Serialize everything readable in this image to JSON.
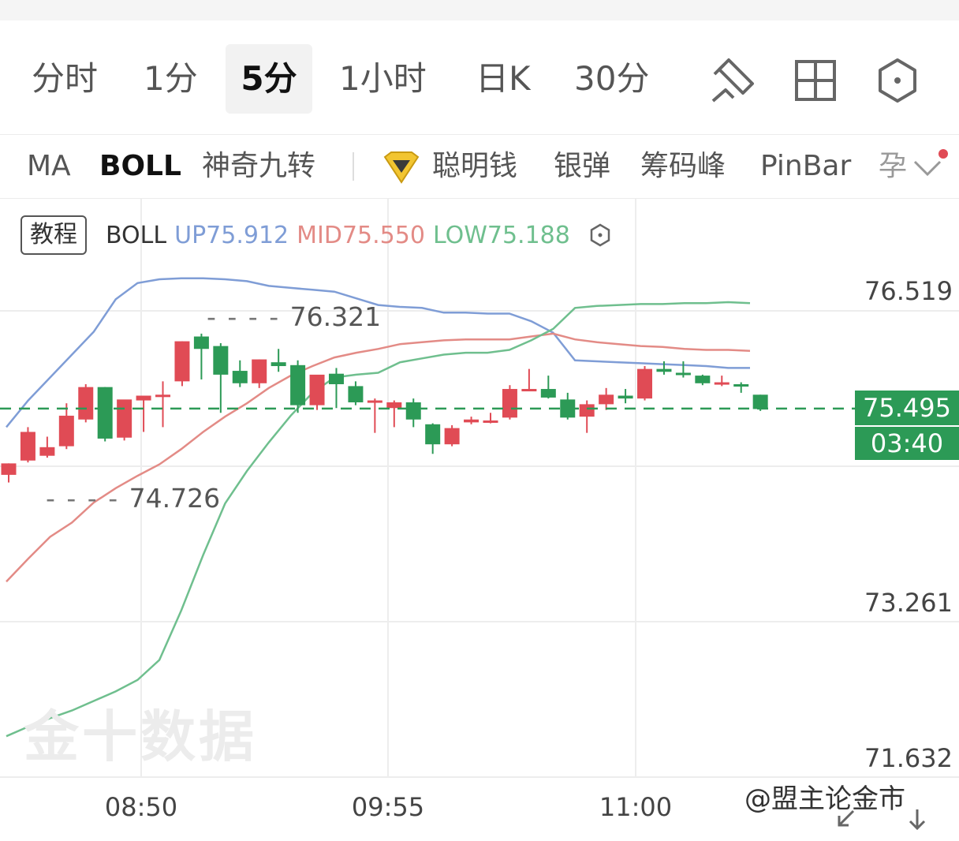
{
  "toolbar": {
    "tabs": [
      "分时",
      "1分",
      "5分",
      "1小时",
      "日K",
      "30分"
    ],
    "active_tab": "5分",
    "icons": [
      "draw-pencil-icon",
      "layout-grid-icon",
      "settings-hexagon-icon"
    ]
  },
  "indicators": {
    "items": [
      "MA",
      "BOLL",
      "神奇九转",
      "聪明钱",
      "银弹",
      "筹码峰",
      "PinBar",
      "孕"
    ],
    "active": "BOLL",
    "more_icon": "chevron-down-icon"
  },
  "legend": {
    "tutorial": "教程",
    "name": "BOLL",
    "up": "UP75.912",
    "mid": "MID75.550",
    "low": "LOW75.188"
  },
  "price": {
    "current": "75.495",
    "countdown": "03:40"
  },
  "watermark": "金十数据",
  "credit": "@盟主论金市",
  "colors": {
    "up": "#e04b55",
    "down": "#2c9a56",
    "upper_band": "#7f9dd6",
    "mid_band": "#e38b86",
    "lower_band": "#6fbf8e",
    "dashed": "#2c9a56"
  },
  "chart_data": {
    "type": "candlestick",
    "y_ticks": [
      "76.519",
      "73.261",
      "71.632"
    ],
    "x_ticks": [
      "08:50",
      "09:55",
      "11:00"
    ],
    "high_label": "76.321",
    "low_label": "74.726",
    "ylim": [
      71.632,
      76.519
    ],
    "current_price": 75.495,
    "candles": [
      {
        "o": 74.8,
        "h": 74.92,
        "c": 74.92,
        "l": 74.72
      },
      {
        "o": 74.95,
        "h": 75.3,
        "c": 75.25,
        "l": 74.93
      },
      {
        "o": 75.0,
        "h": 75.2,
        "c": 75.09,
        "l": 74.98
      },
      {
        "o": 75.1,
        "h": 75.55,
        "c": 75.42,
        "l": 75.07
      },
      {
        "o": 75.38,
        "h": 75.75,
        "c": 75.72,
        "l": 75.35
      },
      {
        "o": 75.72,
        "h": 75.72,
        "c": 75.18,
        "l": 75.15
      },
      {
        "o": 75.19,
        "h": 75.58,
        "c": 75.59,
        "l": 75.16
      },
      {
        "o": 75.58,
        "h": 75.6,
        "c": 75.63,
        "l": 75.25
      },
      {
        "o": 75.63,
        "h": 75.78,
        "c": 75.64,
        "l": 75.3
      },
      {
        "o": 75.78,
        "h": 76.2,
        "c": 76.2,
        "l": 75.73
      },
      {
        "o": 76.25,
        "h": 76.28,
        "c": 76.12,
        "l": 75.8
      },
      {
        "o": 76.15,
        "h": 76.18,
        "c": 75.85,
        "l": 75.45
      },
      {
        "o": 75.89,
        "h": 76.0,
        "c": 75.76,
        "l": 75.72
      },
      {
        "o": 75.76,
        "h": 76.01,
        "c": 76.01,
        "l": 75.71
      },
      {
        "o": 75.98,
        "h": 76.12,
        "c": 75.94,
        "l": 75.88
      },
      {
        "o": 75.95,
        "h": 76.0,
        "c": 75.53,
        "l": 75.45
      },
      {
        "o": 75.53,
        "h": 75.84,
        "c": 75.85,
        "l": 75.48
      },
      {
        "o": 75.86,
        "h": 75.92,
        "c": 75.75,
        "l": 75.5
      },
      {
        "o": 75.73,
        "h": 75.78,
        "c": 75.56,
        "l": 75.53
      },
      {
        "o": 75.56,
        "h": 75.6,
        "c": 75.58,
        "l": 75.24
      },
      {
        "o": 75.5,
        "h": 75.58,
        "c": 75.56,
        "l": 75.3
      },
      {
        "o": 75.56,
        "h": 75.6,
        "c": 75.38,
        "l": 75.3
      },
      {
        "o": 75.33,
        "h": 75.34,
        "c": 75.12,
        "l": 75.02
      },
      {
        "o": 75.12,
        "h": 75.32,
        "c": 75.29,
        "l": 75.1
      },
      {
        "o": 75.35,
        "h": 75.41,
        "c": 75.38,
        "l": 75.33
      },
      {
        "o": 75.36,
        "h": 75.45,
        "c": 75.37,
        "l": 75.34
      },
      {
        "o": 75.4,
        "h": 75.74,
        "c": 75.7,
        "l": 75.38
      },
      {
        "o": 75.69,
        "h": 75.91,
        "c": 75.7,
        "l": 75.68
      },
      {
        "o": 75.7,
        "h": 75.84,
        "c": 75.61,
        "l": 75.6
      },
      {
        "o": 75.59,
        "h": 75.66,
        "c": 75.4,
        "l": 75.38
      },
      {
        "o": 75.41,
        "h": 75.58,
        "c": 75.54,
        "l": 75.24
      },
      {
        "o": 75.54,
        "h": 75.71,
        "c": 75.64,
        "l": 75.48
      },
      {
        "o": 75.63,
        "h": 75.7,
        "c": 75.6,
        "l": 75.55
      },
      {
        "o": 75.6,
        "h": 75.94,
        "c": 75.91,
        "l": 75.58
      },
      {
        "o": 75.91,
        "h": 75.99,
        "c": 75.88,
        "l": 75.85
      },
      {
        "o": 75.87,
        "h": 75.99,
        "c": 75.85,
        "l": 75.82
      },
      {
        "o": 75.84,
        "h": 75.85,
        "c": 75.76,
        "l": 75.74
      },
      {
        "o": 75.76,
        "h": 75.84,
        "c": 75.77,
        "l": 75.73
      },
      {
        "o": 75.75,
        "h": 75.77,
        "c": 75.74,
        "l": 75.66
      },
      {
        "o": 75.64,
        "h": 75.64,
        "c": 75.49,
        "l": 75.47
      }
    ],
    "series": [
      {
        "values": [
          75.3,
          75.58,
          75.82,
          76.06,
          76.3,
          76.64,
          76.81,
          76.85,
          76.86,
          76.86,
          76.85,
          76.83,
          76.78,
          76.76,
          76.74,
          76.72,
          76.65,
          76.58,
          76.56,
          76.55,
          76.5,
          76.5,
          76.49,
          76.49,
          76.41,
          76.29,
          76.0,
          75.99,
          75.98,
          75.97,
          75.96,
          75.95,
          75.94,
          75.92,
          75.92
        ]
      },
      {
        "values": [
          73.68,
          73.92,
          74.15,
          74.3,
          74.51,
          74.66,
          74.79,
          74.91,
          75.07,
          75.25,
          75.41,
          75.55,
          75.71,
          75.84,
          75.94,
          76.03,
          76.08,
          76.12,
          76.17,
          76.19,
          76.21,
          76.22,
          76.22,
          76.22,
          76.25,
          76.28,
          76.22,
          76.19,
          76.17,
          76.15,
          76.14,
          76.12,
          76.11,
          76.11,
          76.1
        ]
      },
      {
        "values": [
          72.06,
          72.16,
          72.25,
          72.33,
          72.43,
          72.53,
          72.65,
          72.86,
          73.38,
          73.96,
          74.5,
          74.84,
          75.14,
          75.42,
          75.66,
          75.82,
          75.85,
          75.87,
          75.98,
          76.02,
          76.06,
          76.08,
          76.08,
          76.11,
          76.21,
          76.33,
          76.55,
          76.57,
          76.58,
          76.59,
          76.59,
          76.6,
          76.6,
          76.61,
          76.6
        ]
      }
    ]
  }
}
